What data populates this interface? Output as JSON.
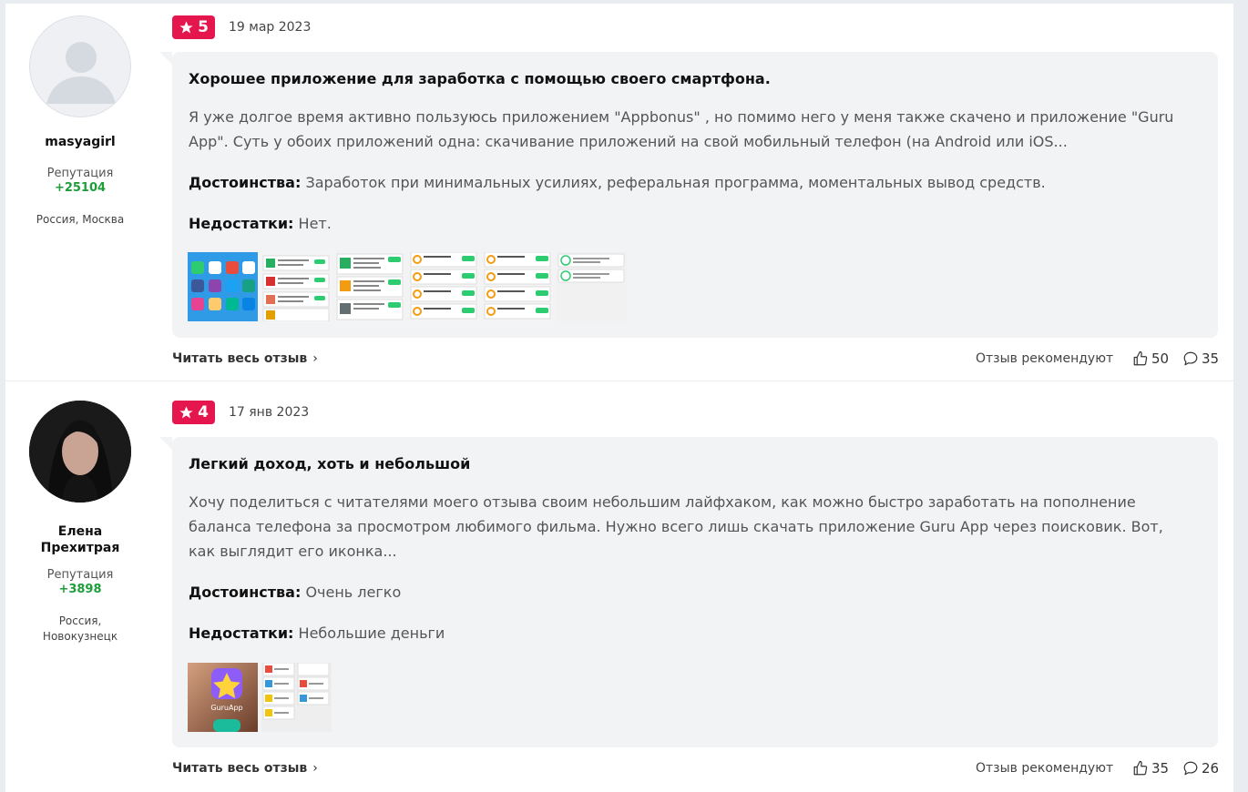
{
  "reviews": [
    {
      "author": {
        "name": "masyagirl",
        "reputation_label": "Репутация",
        "reputation": "+25104",
        "location": "Россия, Москва",
        "avatar": "default-user-icon"
      },
      "rating": "5",
      "date": "19 мар 2023",
      "title": "Хорошее приложение для заработка с помощью своего смартфона.",
      "text": "Я уже долгое время активно пользуюсь приложением \"Appbonus\" , но помимо него у меня также скачено и приложение \"Guru App\". Суть у обоих приложений одна: скачивание приложений на свой мобильный телефон (на Android или iOS...",
      "pros_label": "Достоинства:",
      "pros": "Заработок при минимальных усилиях, реферальная программа, моментальных вывод средств.",
      "cons_label": "Недостатки:",
      "cons": "Нет.",
      "read_more": "Читать весь отзыв",
      "recommend_label": "Отзыв рекомендуют",
      "likes": "50",
      "comments": "35"
    },
    {
      "author": {
        "name": "Елена Прехитрая",
        "reputation_label": "Репутация",
        "reputation": "+3898",
        "location": "Россия, Новокузнецк",
        "avatar": "user-photo"
      },
      "rating": "4",
      "date": "17 янв 2023",
      "title": "Легкий доход, хоть и небольшой",
      "text": "Хочу поделиться с читателями моего отзыва своим небольшим лайфхаком, как можно быстро заработать на пополнение баланса телефона за просмотром любимого фильма. Нужно всего лишь скачать приложение Guru App через поисковик. Вот, как выглядит его иконка...",
      "pros_label": "Достоинства:",
      "pros": "Очень легко",
      "cons_label": "Недостатки:",
      "cons": "Небольшие деньги",
      "read_more": "Читать весь отзыв",
      "recommend_label": "Отзыв рекомендуют",
      "likes": "35",
      "comments": "26"
    }
  ],
  "thumb_labels": {
    "app_name": "GuruApp"
  },
  "colors": {
    "badge": "#e5154d",
    "reputation": "#1e9e3a",
    "card": "#f2f3f5"
  }
}
